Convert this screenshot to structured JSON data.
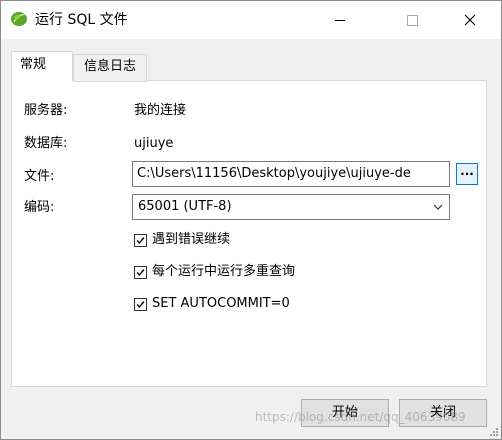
{
  "window": {
    "title": "运行 SQL 文件",
    "app_icon": "green-leaf-icon",
    "controls": [
      "minimize-icon",
      "maximize-icon",
      "close-icon"
    ]
  },
  "tabs": [
    {
      "label": "常规",
      "active": true
    },
    {
      "label": "信息日志",
      "active": false
    }
  ],
  "general": {
    "server_label": "服务器:",
    "server_value": "我的连接",
    "database_label": "数据库:",
    "database_value": "ujiuye",
    "file_label": "文件:",
    "file_value": "C:\\Users\\11156\\Desktop\\youjiye\\ujiuye-de",
    "browse_label": "...",
    "encoding_label": "编码:",
    "encoding_value": "65001 (UTF-8)",
    "options": [
      {
        "label": "遇到错误继续",
        "checked": true
      },
      {
        "label": "每个运行中运行多重查询",
        "checked": true
      },
      {
        "label": "SET AUTOCOMMIT=0",
        "checked": true
      }
    ]
  },
  "buttons": {
    "start_label": "开始",
    "close_label": "关闭"
  },
  "watermark": "https://blog.csdn.net/qq_40639089",
  "colors": {
    "title_bg": "#ffffff",
    "dialog_bg": "#f0f0f0",
    "panel_bg": "#ffffff",
    "focus_border": "#0078d7"
  }
}
